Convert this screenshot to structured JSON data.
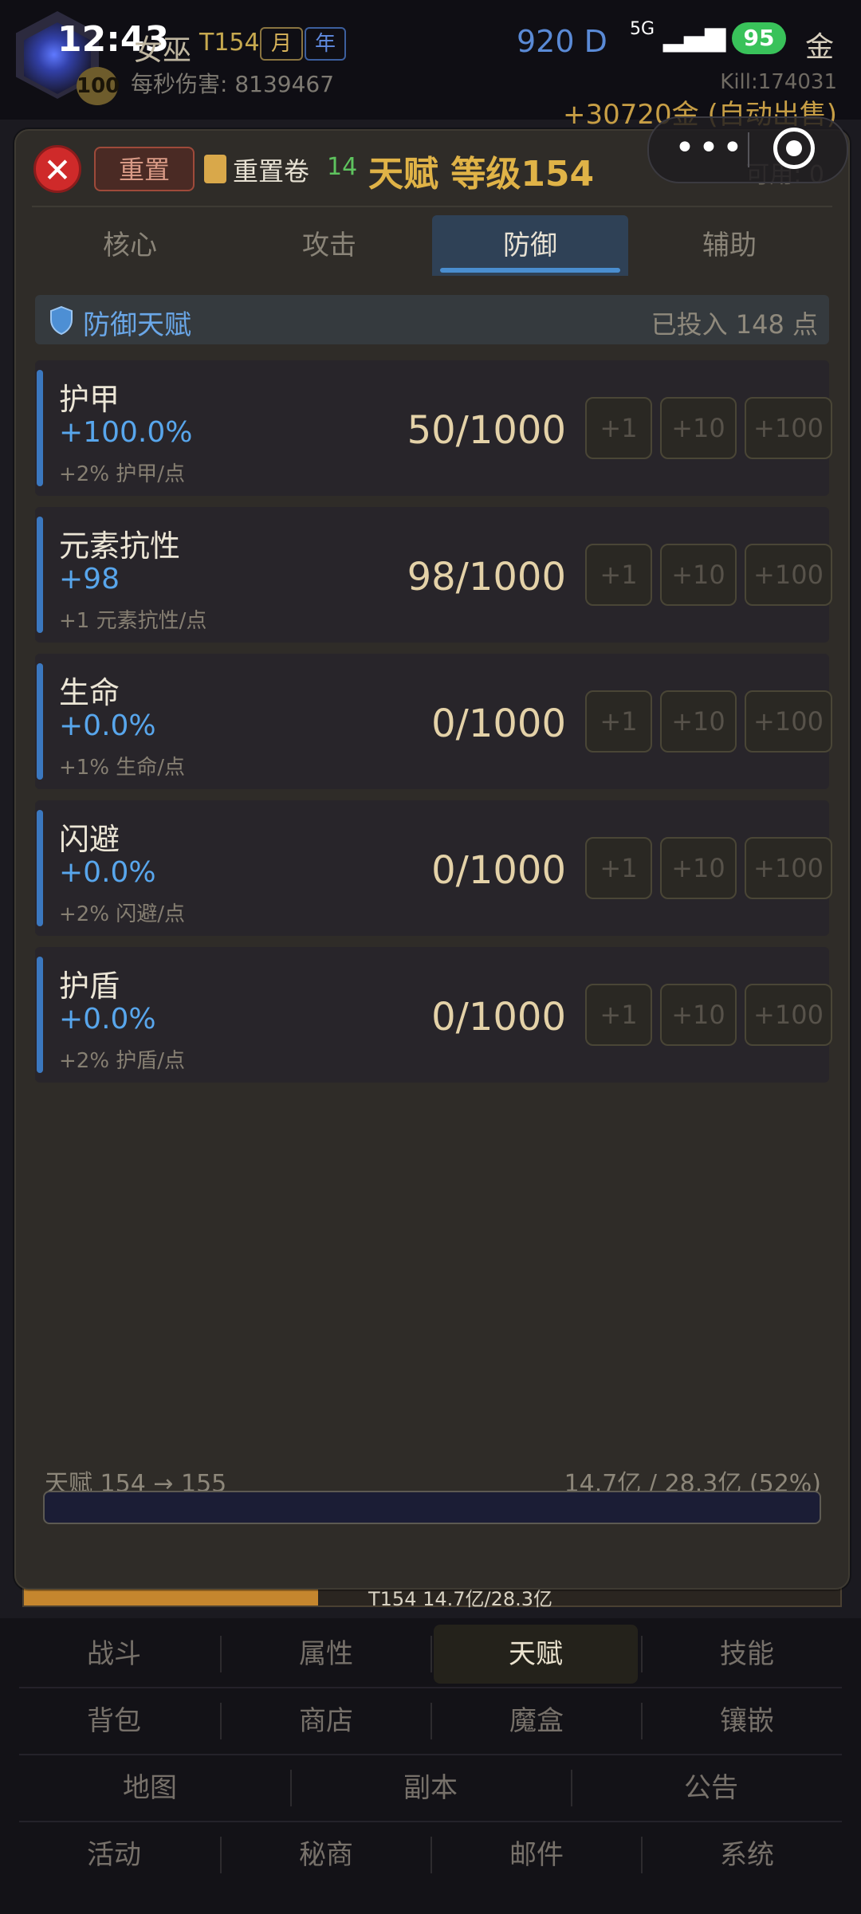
{
  "status_bar": {
    "time": "12:43",
    "network": "5G",
    "battery": "95"
  },
  "player": {
    "name": "女巫",
    "tier": "T154",
    "chip_month": "月",
    "chip_year": "年",
    "avatar_level": "100",
    "dps_label": "每秒伤害: 8139467",
    "d_value": "920 D",
    "gold_char": "金",
    "kill": "Kill:174031",
    "auto_sell": "+30720金 (自动出售)"
  },
  "modal": {
    "close_symbol": "✕",
    "reset_label": "重置",
    "scroll_label": "重置卷",
    "scroll_count": "14",
    "title": "天赋 等级154",
    "available": "可用: 0",
    "tabs": [
      {
        "label": "核心"
      },
      {
        "label": "攻击"
      },
      {
        "label": "防御"
      },
      {
        "label": "辅助"
      }
    ],
    "active_tab": "防御",
    "section": {
      "icon": "shield-icon",
      "title": "防御天赋",
      "invested": "已投入 148 点"
    },
    "talents": [
      {
        "name": "护甲",
        "bonus": "+100.0%",
        "desc": "+2% 护甲/点",
        "progress": "50/1000"
      },
      {
        "name": "元素抗性",
        "bonus": "+98",
        "desc": "+1 元素抗性/点",
        "progress": "98/1000"
      },
      {
        "name": "生命",
        "bonus": "+0.0%",
        "desc": "+1% 生命/点",
        "progress": "0/1000"
      },
      {
        "name": "闪避",
        "bonus": "+0.0%",
        "desc": "+2% 闪避/点",
        "progress": "0/1000"
      },
      {
        "name": "护盾",
        "bonus": "+0.0%",
        "desc": "+2% 护盾/点",
        "progress": "0/1000"
      }
    ],
    "add_buttons": [
      "+1",
      "+10",
      "+100"
    ],
    "xp": {
      "label": "天赋 154 → 155",
      "value": "14.7亿 / 28.3亿 (52%)",
      "fraction": 0.52
    }
  },
  "bg_progress": {
    "text": "T154 14.7亿/28.3亿",
    "fraction": 0.36
  },
  "nav": {
    "rows": [
      [
        "战斗",
        "属性",
        "天赋",
        "技能"
      ],
      [
        "背包",
        "商店",
        "魔盒",
        "镶嵌"
      ],
      [
        "地图",
        "副本",
        "公告"
      ],
      [
        "活动",
        "秘商",
        "邮件",
        "系统"
      ]
    ],
    "active": "天赋"
  },
  "colors": {
    "accent_blue": "#58a6ec",
    "title_gold": "#e0b347",
    "close_red": "#cf2a2a",
    "scroll_green": "#5ec35e"
  }
}
